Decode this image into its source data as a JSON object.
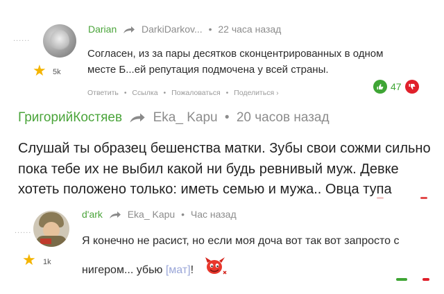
{
  "comments": [
    {
      "author": "Darian",
      "reply_to": "DarkiDarkov...",
      "time": "22 часа назад",
      "rating": "5k",
      "text": "Согласен, из за пары десятков сконцентрированных в одном месте Б...ей репутация подмочена у всей страны.",
      "actions": [
        "Ответить",
        "Ссылка",
        "Пожаловаться",
        "Поделиться ›"
      ],
      "score": "47"
    },
    {
      "author": "ГригорийКостяев",
      "reply_to": "Eka_ Kapu",
      "time": "20 часов назад",
      "text": "Слушай ты образец бешенства матки. Зубы свои сожми сильно пока тебе их не выбил какой ни будь ревнивый муж. Девке хотеть положено только: иметь семью и мужа.. Овца тупа"
    },
    {
      "author": "d'ark",
      "reply_to": "Eka_ Kapu",
      "time": "Час назад",
      "rating": "1k",
      "text_line1": "Я конечно не расист, но если моя доча вот так вот запросто с",
      "text_line2_start": "нигером... убью ",
      "text_censored": "[мат]",
      "text_line2_end": "!"
    }
  ],
  "separators": {
    "dot": "•",
    "dots": "......"
  },
  "icons": {
    "star": "star-icon",
    "reply_arrow": "reply-arrow-icon",
    "upvote": "upvote-icon",
    "downvote": "downvote-icon",
    "devil": "devil-emoji-icon"
  },
  "colors": {
    "accent_green": "#4aa43a",
    "vote_up": "#3fa535",
    "vote_down": "#e0202b",
    "star": "#f4b400",
    "censored": "#9aa6d8"
  }
}
